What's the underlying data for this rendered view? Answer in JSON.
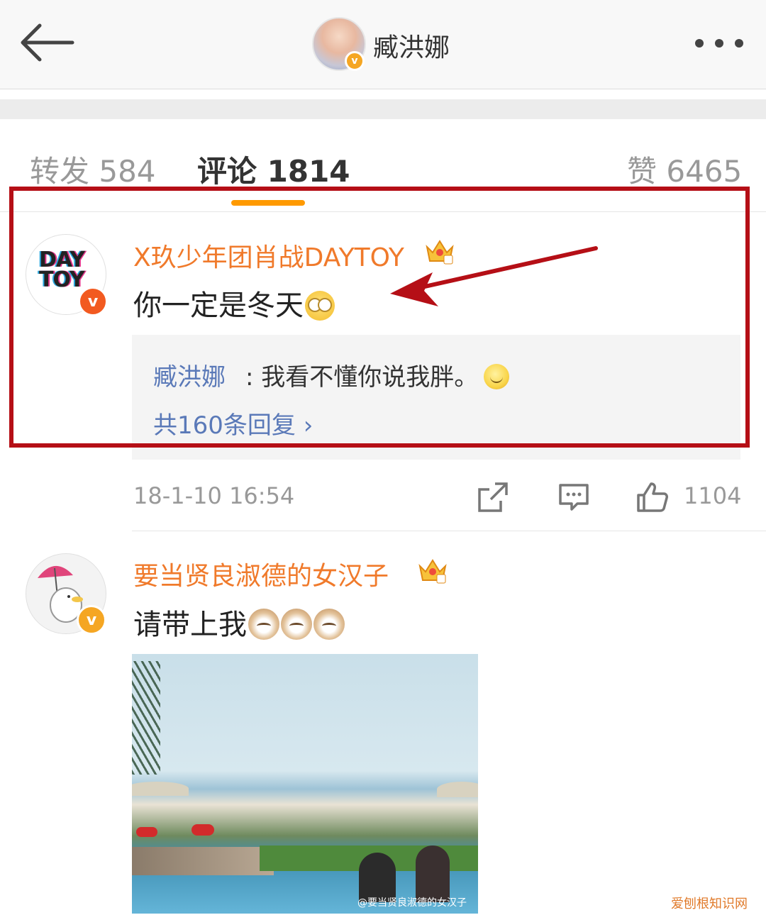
{
  "header": {
    "title": "臧洪娜",
    "avatar_badge": "v"
  },
  "tabs": {
    "repost": "转发 584",
    "comment": "评论 1814",
    "like": "赞 6465"
  },
  "comments": [
    {
      "username": "X玖少年团肖战DAYTOY",
      "avatar_text": "DAY TOY",
      "badge": "v",
      "text": "你一定是冬天",
      "reply": {
        "name": "臧洪娜",
        "text": ": 我看不懂你说我胖。"
      },
      "reply_count": "共160条回复 ›",
      "time": "18-1-10 16:54",
      "likes": "1104"
    },
    {
      "username": "要当贤良淑德的女汉子",
      "badge": "v",
      "text": "请带上我",
      "image_watermark": "@要当贤良淑德的女汉子"
    }
  ],
  "colors": {
    "username": "#f07a2b",
    "reply_link": "#5a79b8",
    "tab_active_underline": "#ff9a00",
    "highlight_box": "#b50f16"
  },
  "site_watermark": "爱刨根知识网"
}
